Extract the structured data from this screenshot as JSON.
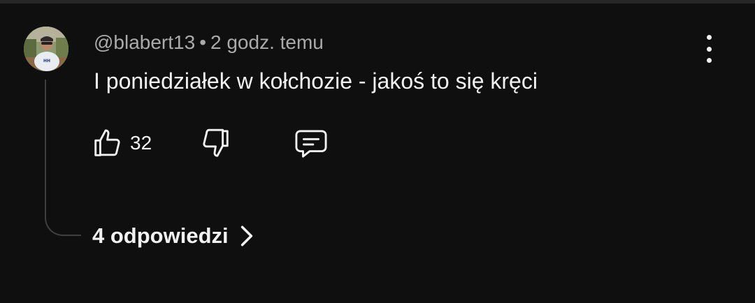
{
  "comment": {
    "author": "@blabert13",
    "separator": "•",
    "time_ago": "2 godz. temu",
    "text": "I poniedziałek w kołchozie - jakoś to się kręci",
    "like_count": "32",
    "replies_label": "4 odpowiedzi"
  },
  "icons": {
    "like": "thumbs-up-icon",
    "dislike": "thumbs-down-icon",
    "reply": "comment-icon",
    "menu": "more-vertical-icon",
    "expand": "chevron-right-icon"
  },
  "colors": {
    "background": "#0f0f0f",
    "primary_text": "#f1f1f1",
    "secondary_text": "#aaaaaa",
    "thread_line": "#3f3f3f"
  }
}
